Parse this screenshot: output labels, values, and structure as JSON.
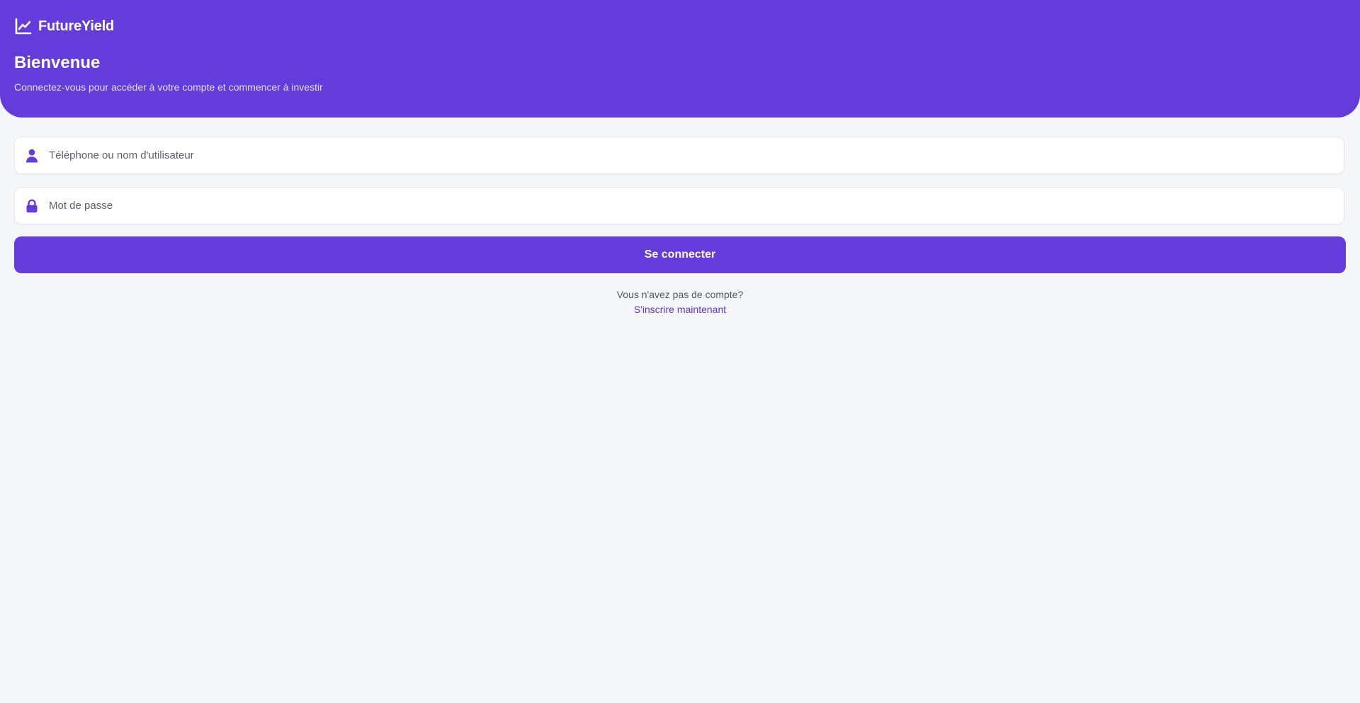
{
  "brand": {
    "name": "FutureYield",
    "icon": "chart-line-icon"
  },
  "header": {
    "title": "Bienvenue",
    "subtitle": "Connectez-vous pour accéder à votre compte et commencer à investir"
  },
  "form": {
    "username": {
      "placeholder": "Téléphone ou nom d'utilisateur",
      "value": "",
      "icon": "user-icon"
    },
    "password": {
      "placeholder": "Mot de passe",
      "value": "",
      "icon": "lock-icon"
    },
    "submit_label": "Se connecter"
  },
  "signup": {
    "prompt": "Vous n'avez pas de compte?",
    "link_label": "S'inscrire maintenant"
  },
  "colors": {
    "primary": "#633cdb",
    "background": "#f5f6fa",
    "link": "#5a35c8"
  }
}
